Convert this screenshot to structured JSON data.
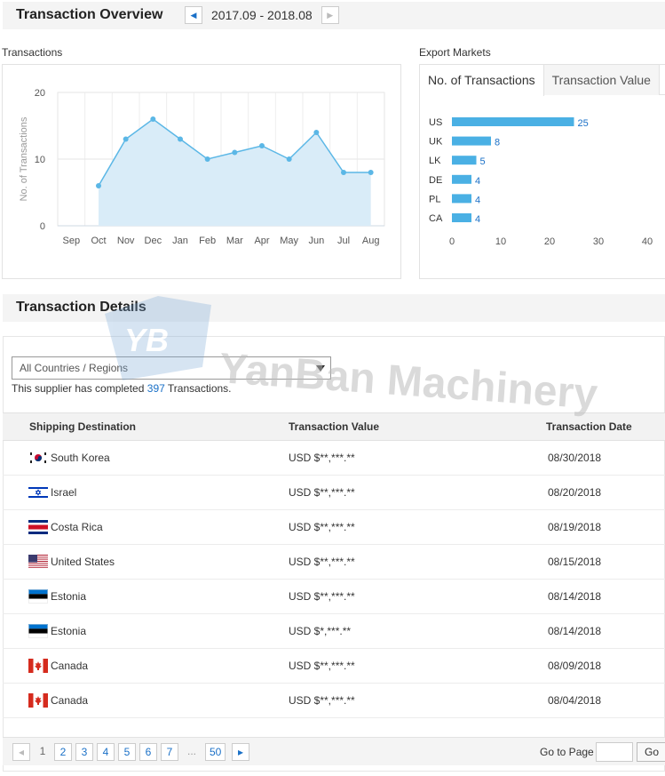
{
  "overview": {
    "title": "Transaction Overview",
    "period": "2017.09 - 2018.08"
  },
  "transactions_label": "Transactions",
  "export_label": "Export Markets",
  "export_tabs": [
    "No. of Transactions",
    "Transaction Value"
  ],
  "chart_data": [
    {
      "type": "area",
      "ylabel": "No. of Transactions",
      "categories": [
        "Sep",
        "Oct",
        "Nov",
        "Dec",
        "Jan",
        "Feb",
        "Mar",
        "Apr",
        "May",
        "Jun",
        "Jul",
        "Aug"
      ],
      "values": [
        null,
        6,
        13,
        16,
        13,
        10,
        11,
        12,
        10,
        14,
        8,
        8
      ],
      "ylim": [
        0,
        20
      ],
      "yticks": [
        "0",
        "10",
        "20"
      ],
      "grid": true,
      "color": "#5bb7e6"
    },
    {
      "type": "bar",
      "orientation": "horizontal",
      "categories": [
        "US",
        "UK",
        "LK",
        "DE",
        "PL",
        "CA"
      ],
      "values": [
        25,
        8,
        5,
        4,
        4,
        4
      ],
      "xlim": [
        0,
        40
      ],
      "xticks": [
        "0",
        "10",
        "20",
        "30",
        "40"
      ],
      "color": "#4ab0e4"
    }
  ],
  "details": {
    "title": "Transaction Details",
    "filter_value": "All Countries / Regions",
    "summary_prefix": "This supplier has completed",
    "summary_count": "397",
    "summary_suffix": "Transactions."
  },
  "table": {
    "headers": [
      "Shipping Destination",
      "Transaction Value",
      "Transaction Date"
    ],
    "rows": [
      {
        "country": "South Korea",
        "flag": "kr",
        "value": "USD $**,***.**",
        "date": "08/30/2018"
      },
      {
        "country": "Israel",
        "flag": "il",
        "value": "USD $**,***.**",
        "date": "08/20/2018"
      },
      {
        "country": "Costa Rica",
        "flag": "cr",
        "value": "USD $**,***.**",
        "date": "08/19/2018"
      },
      {
        "country": "United States",
        "flag": "us",
        "value": "USD $**,***.**",
        "date": "08/15/2018"
      },
      {
        "country": "Estonia",
        "flag": "ee",
        "value": "USD $**,***.**",
        "date": "08/14/2018"
      },
      {
        "country": "Estonia",
        "flag": "ee",
        "value": "USD $*,***.**",
        "date": "08/14/2018"
      },
      {
        "country": "Canada",
        "flag": "ca",
        "value": "USD $**,***.**",
        "date": "08/09/2018"
      },
      {
        "country": "Canada",
        "flag": "ca",
        "value": "USD $**,***.**",
        "date": "08/04/2018"
      }
    ]
  },
  "pagination": {
    "pages": [
      "1",
      "2",
      "3",
      "4",
      "5",
      "6",
      "7",
      "...",
      "50"
    ],
    "current": "1",
    "goto_label": "Go to Page",
    "go_label": "Go"
  },
  "watermark": {
    "logo": "YB",
    "text": "YanBan Machinery"
  }
}
